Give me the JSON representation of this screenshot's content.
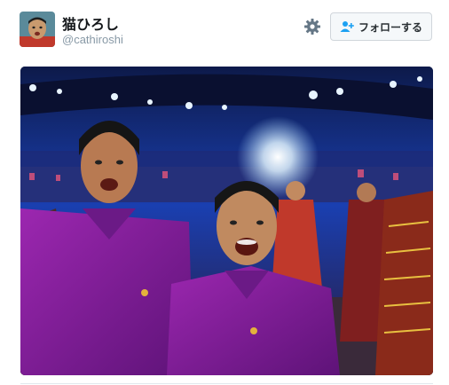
{
  "tweet": {
    "author": {
      "display_name": "猫ひろし",
      "handle": "@cathiroshi"
    },
    "follow_button": {
      "label": "フォローする",
      "icon": "add-user-icon"
    },
    "settings_icon": "gear-icon",
    "photo": {
      "subject": "selfie-stadium-crowd"
    }
  },
  "colors": {
    "name_text": "#14171a",
    "handle_text": "#8899a6",
    "follow_bg": "#f5f8fa",
    "follow_border": "#d0d6db",
    "follow_icon": "#1da1f2",
    "shirt_purple": "#7b1fa2",
    "stadium_blue": "#1a3fb0"
  }
}
